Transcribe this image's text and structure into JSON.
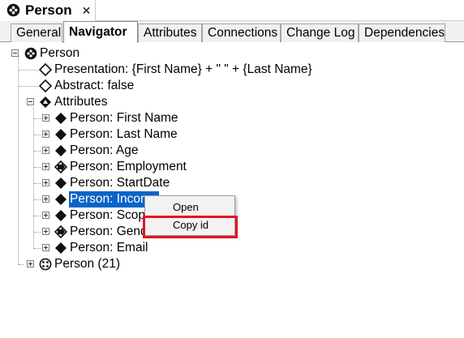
{
  "editor_tab": {
    "title": "Person",
    "close_glyph": "✕",
    "icon": "class-icon"
  },
  "tabs": [
    {
      "label": "General",
      "active": false
    },
    {
      "label": "Navigator",
      "active": true
    },
    {
      "label": "Attributes",
      "active": false
    },
    {
      "label": "Connections",
      "active": false
    },
    {
      "label": "Change Log",
      "active": false
    },
    {
      "label": "Dependencies",
      "active": false
    }
  ],
  "tree": {
    "root": {
      "label": "Person",
      "icon": "class-icon"
    },
    "presentation": {
      "label": "Presentation: {First Name} + \" \" + {Last Name}",
      "icon": "diamond-outline-icon"
    },
    "abstract": {
      "label": "Abstract: false",
      "icon": "diamond-outline-icon"
    },
    "attributes": {
      "label": "Attributes",
      "icon": "attributes-icon"
    },
    "attribute_items": [
      {
        "label": "Person: First Name",
        "icon": "diamond-filled-icon"
      },
      {
        "label": "Person: Last Name",
        "icon": "diamond-filled-icon"
      },
      {
        "label": "Person: Age",
        "icon": "diamond-filled-icon"
      },
      {
        "label": "Person: Employment",
        "icon": "diamond-arrow-icon"
      },
      {
        "label": "Person: StartDate",
        "icon": "diamond-filled-icon"
      },
      {
        "label": "Person: Income",
        "icon": "diamond-filled-icon",
        "selected": true
      },
      {
        "label": "Person: Scope",
        "icon": "diamond-filled-icon"
      },
      {
        "label": "Person: Gender",
        "icon": "diamond-arrow-icon"
      },
      {
        "label": "Person: Email",
        "icon": "diamond-filled-icon"
      }
    ],
    "instances": {
      "label": "Person (21)",
      "icon": "instances-icon"
    }
  },
  "context_menu": {
    "items": [
      {
        "label": "Open"
      },
      {
        "label": "Copy id",
        "highlighted": true
      }
    ]
  },
  "colors": {
    "selection": "#0a64c8",
    "highlight_box": "#e3141f",
    "tabbar": "#f0f0f0"
  }
}
